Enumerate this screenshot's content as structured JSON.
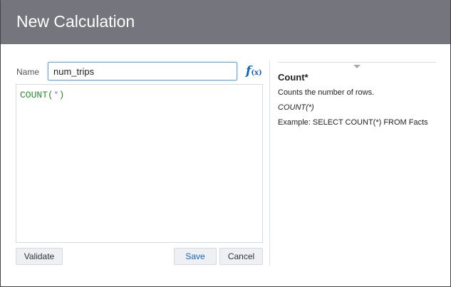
{
  "header": {
    "title": "New Calculation"
  },
  "form": {
    "name_label": "Name",
    "name_value": "num_trips",
    "fx_icon": "f",
    "fx_sub": "(x)",
    "expression": {
      "func": "COUNT",
      "open": "(",
      "arg": "*",
      "close": ")"
    }
  },
  "buttons": {
    "validate": "Validate",
    "save": "Save",
    "cancel": "Cancel"
  },
  "help": {
    "title": "Count*",
    "description": "Counts the number of rows.",
    "syntax": "COUNT(*)",
    "example": "Example: SELECT COUNT(*) FROM Facts"
  },
  "colors": {
    "header": "#75767d",
    "accent": "#1565c0"
  }
}
